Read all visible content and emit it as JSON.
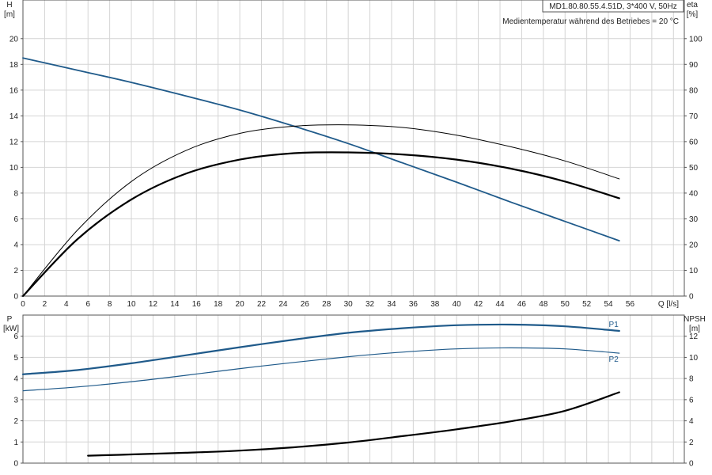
{
  "header": {
    "model": "MD1.80.80.55.4.51D, 3*400 V, 50Hz",
    "note": "Medientemperatur während des Betriebes = 20 °C"
  },
  "colors": {
    "blue": "#1f5a8a",
    "black": "#000000",
    "grid": "#d4d4d4"
  },
  "chart_data": [
    {
      "type": "line",
      "xlabel": "Q [l/s]",
      "x_unit_label": "Q [l/s]",
      "ylabel": "H",
      "ylabel_unit": "[m]",
      "y2label": "eta",
      "y2label_unit": "[%]",
      "xlim": [
        0,
        61
      ],
      "ylim": [
        0,
        23
      ],
      "y2lim": [
        0,
        115
      ],
      "x_ticks": [
        0,
        2,
        4,
        6,
        8,
        10,
        12,
        14,
        16,
        18,
        20,
        22,
        24,
        26,
        28,
        30,
        32,
        34,
        36,
        38,
        40,
        42,
        44,
        46,
        48,
        50,
        52,
        54,
        56
      ],
      "y_ticks": [
        0,
        2,
        4,
        6,
        8,
        10,
        12,
        14,
        16,
        18,
        20
      ],
      "y2_ticks": [
        0,
        10,
        20,
        30,
        40,
        50,
        60,
        70,
        80,
        90,
        100
      ],
      "grid": true,
      "series": [
        {
          "axis": "left",
          "color": "#1f5a8a",
          "width": 1.8,
          "x": [
            0,
            5,
            10,
            15,
            20,
            25,
            30,
            35,
            40,
            45,
            50,
            55
          ],
          "y": [
            18.5,
            17.55,
            16.6,
            15.55,
            14.45,
            13.2,
            11.85,
            10.35,
            8.85,
            7.3,
            5.8,
            4.3
          ]
        },
        {
          "axis": "right",
          "color": "#000000",
          "width": 1,
          "x": [
            0,
            5,
            10,
            15,
            20,
            25,
            30,
            35,
            40,
            45,
            50,
            55
          ],
          "y": [
            0,
            25.5,
            44.5,
            56.5,
            63.2,
            66,
            66.5,
            65.5,
            62.5,
            58,
            52.5,
            45.5
          ]
        },
        {
          "axis": "right",
          "color": "#000000",
          "width": 2.2,
          "x": [
            0,
            5,
            10,
            15,
            20,
            25,
            30,
            35,
            40,
            45,
            50,
            55
          ],
          "y": [
            0,
            22,
            37.5,
            47.5,
            53,
            55.5,
            55.8,
            55,
            53,
            49.5,
            44.5,
            38
          ]
        }
      ]
    },
    {
      "type": "line",
      "xlim": [
        0,
        61
      ],
      "ylabel": "P",
      "ylabel_unit": "[kW]",
      "y2label": "NPSH",
      "y2label_unit": "[m]",
      "ylim": [
        0,
        7
      ],
      "y2lim": [
        0,
        14
      ],
      "y_ticks": [
        0,
        1,
        2,
        3,
        4,
        5,
        6
      ],
      "y2_ticks": [
        0,
        2,
        4,
        6,
        8,
        10,
        12
      ],
      "grid": true,
      "series": [
        {
          "name": "P1",
          "axis": "left",
          "color": "#1f5a8a",
          "width": 2.2,
          "x": [
            0,
            5,
            10,
            15,
            20,
            25,
            30,
            35,
            40,
            45,
            50,
            55
          ],
          "y": [
            4.2,
            4.4,
            4.72,
            5.1,
            5.48,
            5.84,
            6.16,
            6.38,
            6.52,
            6.55,
            6.47,
            6.25
          ]
        },
        {
          "name": "P2",
          "axis": "left",
          "color": "#1f5a8a",
          "width": 1.2,
          "x": [
            0,
            5,
            10,
            15,
            20,
            25,
            30,
            35,
            40,
            45,
            50,
            55
          ],
          "y": [
            3.42,
            3.6,
            3.85,
            4.15,
            4.47,
            4.76,
            5.03,
            5.25,
            5.4,
            5.45,
            5.4,
            5.2
          ]
        },
        {
          "axis": "right",
          "color": "#000000",
          "width": 2.2,
          "x": [
            6,
            10,
            15,
            20,
            25,
            30,
            35,
            40,
            45,
            50,
            55
          ],
          "y": [
            0.7,
            0.82,
            0.98,
            1.18,
            1.5,
            1.95,
            2.55,
            3.2,
            3.95,
            4.95,
            6.7
          ]
        }
      ]
    }
  ]
}
